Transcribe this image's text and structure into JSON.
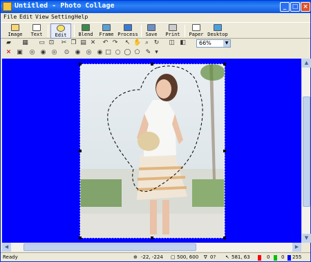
{
  "window": {
    "title": "Untitled - Photo Collage"
  },
  "menu": [
    "File",
    "Edit",
    "View",
    "Setting",
    "Help"
  ],
  "main_toolbar": [
    {
      "label": "Image",
      "icon": "image-icon"
    },
    {
      "label": "Text",
      "icon": "text-icon"
    },
    {
      "label": "Edit",
      "icon": "edit-icon"
    },
    {
      "label": "Blend",
      "icon": "blend-icon"
    },
    {
      "label": "Frame",
      "icon": "frame-icon"
    },
    {
      "label": "Process",
      "icon": "process-icon"
    },
    {
      "label": "Save",
      "icon": "save-icon"
    },
    {
      "label": "Print",
      "icon": "print-icon"
    },
    {
      "label": "Paper",
      "icon": "paper-icon"
    },
    {
      "label": "Desktop",
      "icon": "desktop-icon"
    }
  ],
  "zoom": {
    "value": "66%"
  },
  "status": {
    "ready": "Ready",
    "offset": "-22, -224",
    "size": "500, 600",
    "angle": "0?",
    "cursor": "581, 63",
    "red": "0",
    "green": "0",
    "blue": "255"
  },
  "colors": {
    "canvas_bg": "#0000ff",
    "titlebar": "#0a5ee8",
    "status_red": "#ff0000",
    "status_green": "#00c000",
    "status_blue": "#0000ff"
  }
}
